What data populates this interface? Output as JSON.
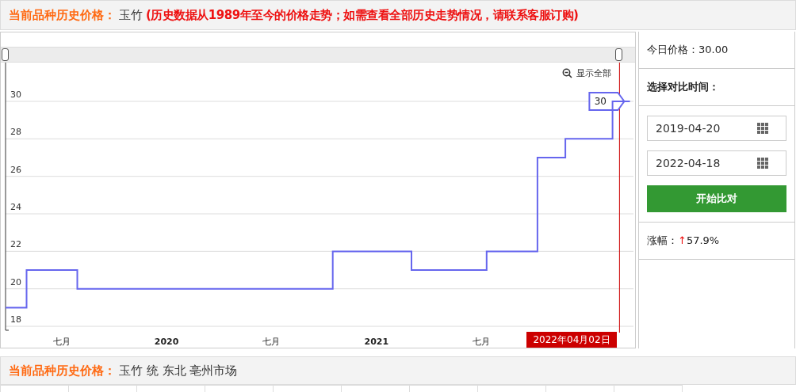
{
  "header": {
    "label": "当前品种历史价格：",
    "variety": "玉竹",
    "note": "(历史数据从1989年至今的价格走势；如需查看全部历史走势情况，请联系客服订购)"
  },
  "chart": {
    "show_all": "显示全部",
    "tooltip_value": "30",
    "chart_data": {
      "type": "line",
      "x": [
        2019.233,
        2019.333,
        2019.333,
        2019.575,
        2019.575,
        2020.792,
        2020.792,
        2021.167,
        2021.167,
        2021.525,
        2021.525,
        2021.767,
        2021.767,
        2021.9,
        2021.9,
        2022.125,
        2022.125,
        2022.208
      ],
      "series": [
        {
          "color": "#6666ee",
          "values": [
            19,
            19,
            21,
            21,
            20,
            20,
            22,
            22,
            21,
            21,
            22,
            22,
            27,
            27,
            28,
            28,
            30,
            30
          ]
        }
      ],
      "xlim": [
        2019.233,
        2022.217
      ],
      "ylim": [
        17.79,
        32.07
      ],
      "xticks": [
        {
          "value": 2019.5,
          "label": "七月"
        },
        {
          "value": 2020,
          "label": "2020"
        },
        {
          "value": 2020.5,
          "label": "七月"
        },
        {
          "value": 2021,
          "label": "2021"
        },
        {
          "value": 2021.5,
          "label": "七月"
        }
      ],
      "yticks": [
        18,
        20,
        22,
        24,
        26,
        28,
        30
      ],
      "grid": true,
      "ref_lines": [
        {
          "axis": "x",
          "value": 2022.158,
          "color": "#cc0000",
          "label": "2022年04月02日"
        }
      ]
    }
  },
  "side": {
    "today_label": "今日价格：",
    "today_value": "30.00",
    "compare_title": "选择对比时间：",
    "date_from": "2019-04-20",
    "date_to": "2022-04-18",
    "compare_button": "开始比对",
    "change_label": "涨幅：",
    "change_arrow": "↑",
    "change_value": "57.9%"
  },
  "footer": {
    "label": "当前品种历史价格：",
    "detail": "玉竹 统 东北 亳州市场"
  }
}
